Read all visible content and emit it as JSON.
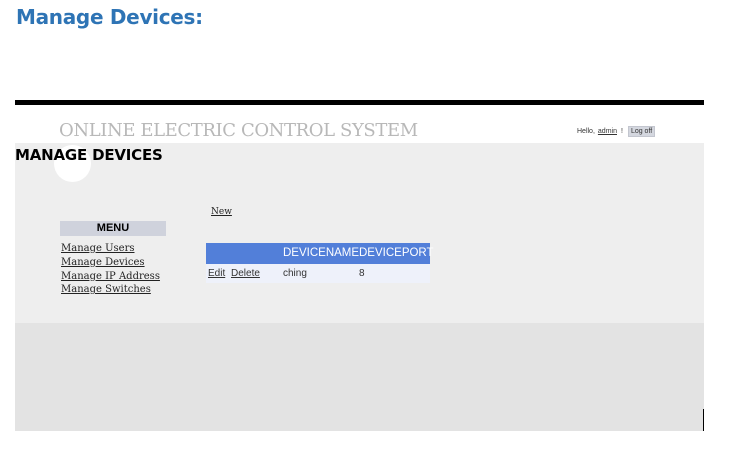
{
  "doc_heading": "Manage Devices:",
  "header": {
    "site_title": "ONLINE ELECTRIC CONTROL SYSTEM",
    "greeting": "Hello,",
    "username": "admin",
    "separator": "!",
    "logoff_label": "Log off"
  },
  "page": {
    "title": "MANAGE DEVICES"
  },
  "menu": {
    "header": "MENU",
    "items": [
      "Manage Users",
      "Manage Devices",
      "Manage IP Address",
      "Manage Switches"
    ]
  },
  "content": {
    "new_label": "New",
    "columns": [
      "DEVICENAME",
      "DEVICEPORT"
    ],
    "rows": [
      {
        "edit": "Edit",
        "delete": "Delete",
        "devicename": "ching",
        "deviceport": "8"
      }
    ]
  },
  "colors": {
    "heading_blue": "#2e74b5",
    "grid_header": "#527fd9",
    "menu_header": "#cfd2dc",
    "panel_bg": "#eeeeee"
  }
}
